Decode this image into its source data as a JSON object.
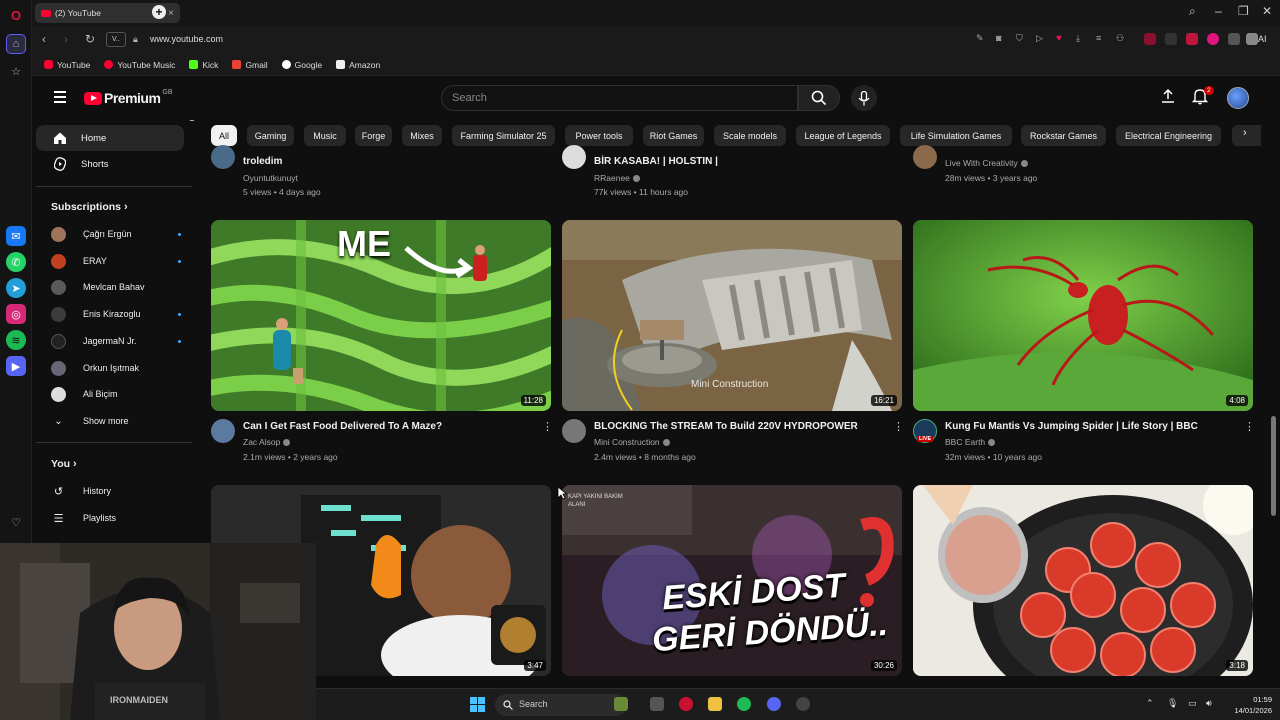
{
  "browser": {
    "tab_title": "(2) YouTube",
    "url": "www.youtube.com",
    "url_badge": "V..",
    "ai_label": "AI",
    "bookmarks": [
      "YouTube",
      "YouTube Music",
      "Kick",
      "Gmail",
      "Google",
      "Amazon"
    ]
  },
  "header": {
    "brand": "Premium",
    "country": "GB",
    "search_placeholder": "Search",
    "notifications": "2"
  },
  "sidebar": {
    "home": "Home",
    "shorts": "Shorts",
    "subscriptions_heading": "Subscriptions",
    "subscriptions": [
      "Çağrı Ergün",
      "ERAY",
      "Mevlcan Bahav",
      "Enis Kirazoglu",
      "JagermaN Jr.",
      "Orkun Işıtmak",
      "Ali Biçim"
    ],
    "show_more": "Show more",
    "you_heading": "You",
    "history": "History",
    "playlists": "Playlists"
  },
  "chips": [
    "All",
    "Gaming",
    "Music",
    "Forge",
    "Mixes",
    "Farming Simulator 25",
    "Power tools",
    "Riot Games",
    "Scale models",
    "League of Legends",
    "Life Simulation Games",
    "Rockstar Games",
    "Electrical Engineering"
  ],
  "top_row": [
    {
      "title": "troledim",
      "channel": "Oyuntutkunuyt",
      "stats": "5 views • 4 days ago"
    },
    {
      "title": "BİR KASABA! | HOLSTIN |",
      "channel": "RRaenee",
      "stats": "77k views • 11 hours ago"
    },
    {
      "title": "",
      "channel": "Live With Creativity",
      "stats": "28m views • 3 years ago"
    }
  ],
  "videos": [
    {
      "title": "Can I Get Fast Food Delivered To A Maze?",
      "channel": "Zac Alsop",
      "stats": "2.1m views • 2 years ago",
      "duration": "11:28",
      "overlay": "ME"
    },
    {
      "title": "BLOCKING The STREAM To Build 220V HYDROPOWER",
      "channel": "Mini Construction",
      "stats": "2.4m views • 8 months ago",
      "duration": "16:21",
      "overlay": "Mini Construction"
    },
    {
      "title": "Kung Fu Mantis Vs Jumping Spider | Life Story | BBC",
      "channel": "BBC Earth",
      "stats": "32m views • 10 years ago",
      "duration": "4:08",
      "live_badge": "LIVE"
    }
  ],
  "bottom_row": [
    {
      "duration": "3:47"
    },
    {
      "duration": "30:26",
      "overlay_line1": "ESKİ DOST",
      "overlay_line2": "GERİ DÖNDÜ..",
      "sign": "KAPI YAKINI BAKIM ALANI"
    },
    {
      "duration": "3:18"
    }
  ],
  "taskbar": {
    "search": "Search",
    "time": "01:59",
    "date": "14/01/2026"
  }
}
